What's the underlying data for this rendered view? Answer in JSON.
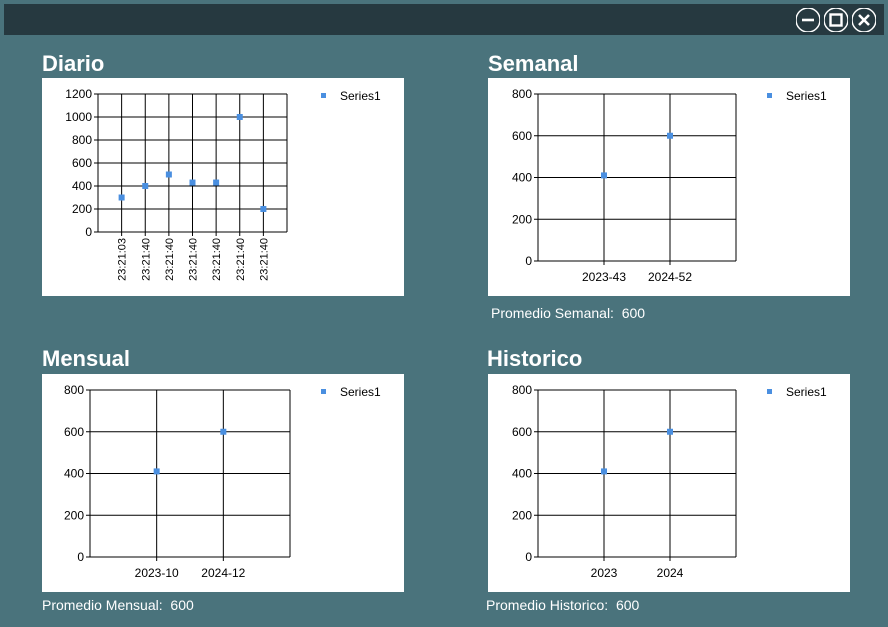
{
  "window": {
    "controls": [
      "minimize-icon",
      "maximize-icon",
      "close-icon"
    ]
  },
  "colors": {
    "background": "#4a737c",
    "titlebar": "#263940",
    "marker": "#4a8fe0"
  },
  "charts": {
    "diario": {
      "heading": "Diario"
    },
    "semanal": {
      "heading": "Semanal",
      "avg_label": "Promedio Semanal:",
      "avg_value": "600"
    },
    "mensual": {
      "heading": "Mensual",
      "avg_label": "Promedio Mensual:",
      "avg_value": "600"
    },
    "historico": {
      "heading": "Historico",
      "avg_label": "Promedio Historico:",
      "avg_value": "600"
    }
  },
  "chart_data": [
    {
      "type": "scatter",
      "title": "Diario",
      "categories": [
        "23:21:03",
        "23:21:40",
        "23:21:40",
        "23:21:40",
        "23:21:40",
        "23:21:40",
        "23:21:40"
      ],
      "series": [
        {
          "name": "Series1",
          "values": [
            300,
            400,
            500,
            430,
            430,
            1000,
            200
          ]
        }
      ],
      "ylim": [
        0,
        1200
      ],
      "yticks": [
        0,
        200,
        400,
        600,
        800,
        1000,
        1200
      ],
      "grid": true,
      "legend": "top-right",
      "rotated_xlabels": true
    },
    {
      "type": "scatter",
      "title": "Semanal",
      "categories": [
        "2023-43",
        "2024-52"
      ],
      "series": [
        {
          "name": "Series1",
          "values": [
            410,
            600
          ]
        }
      ],
      "ylim": [
        0,
        800
      ],
      "yticks": [
        0,
        200,
        400,
        600,
        800
      ],
      "grid": true,
      "legend": "top-right"
    },
    {
      "type": "scatter",
      "title": "Mensual",
      "categories": [
        "2023-10",
        "2024-12"
      ],
      "series": [
        {
          "name": "Series1",
          "values": [
            410,
            600
          ]
        }
      ],
      "ylim": [
        0,
        800
      ],
      "yticks": [
        0,
        200,
        400,
        600,
        800
      ],
      "grid": true,
      "legend": "top-right"
    },
    {
      "type": "scatter",
      "title": "Historico",
      "categories": [
        "2023",
        "2024"
      ],
      "series": [
        {
          "name": "Series1",
          "values": [
            410,
            600
          ]
        }
      ],
      "ylim": [
        0,
        800
      ],
      "yticks": [
        0,
        200,
        400,
        600,
        800
      ],
      "grid": true,
      "legend": "top-right"
    }
  ]
}
